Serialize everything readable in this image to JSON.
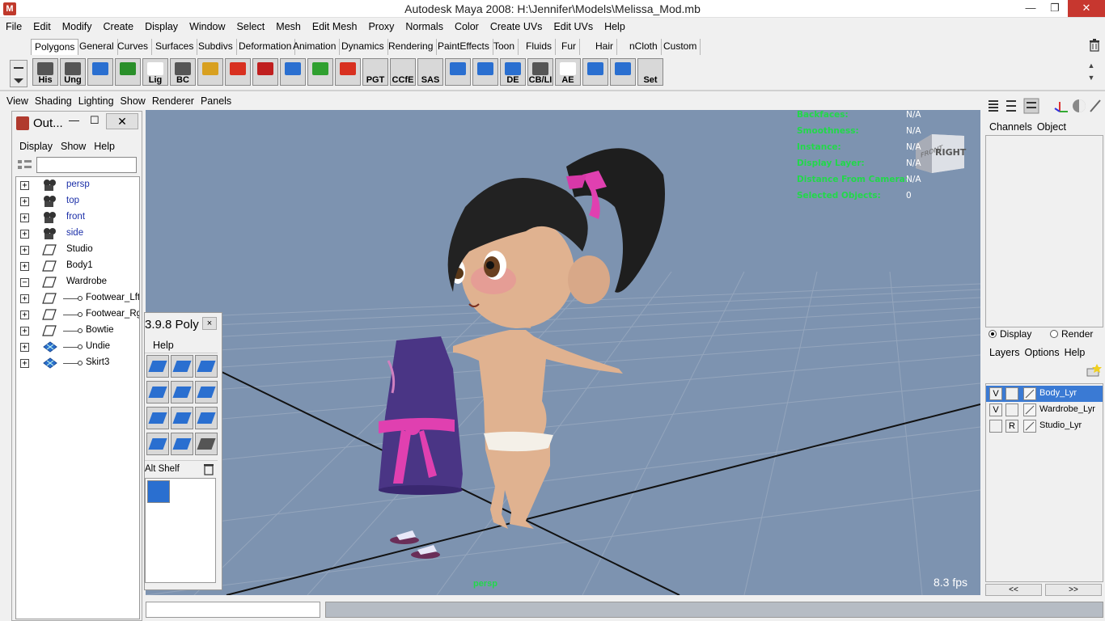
{
  "window": {
    "title": "Autodesk Maya 2008: H:\\Jennifer\\Models\\Melissa_Mod.mb",
    "minimize": "—",
    "maximize": "❐",
    "close": "✕"
  },
  "menubar": [
    "File",
    "Edit",
    "Modify",
    "Create",
    "Display",
    "Window",
    "Select",
    "Mesh",
    "Edit Mesh",
    "Proxy",
    "Normals",
    "Color",
    "Create UVs",
    "Edit UVs",
    "Help"
  ],
  "shelf_tabs": [
    "Polygons",
    "General",
    "Curves",
    "Surfaces",
    "Subdivs",
    "Deformation",
    "Animation",
    "Dynamics",
    "Rendering",
    "PaintEffects",
    "Toon",
    "Fluids",
    "Fur",
    "Hair",
    "nCloth",
    "Custom"
  ],
  "shelf_active_tab": "Polygons",
  "shelf_icons": [
    {
      "label": "His",
      "color": "#555555"
    },
    {
      "label": "Ung",
      "color": "#555555"
    },
    {
      "label": "",
      "color": "#2a6fd0"
    },
    {
      "label": "",
      "color": "#2a8f2a"
    },
    {
      "label": "Lig",
      "color": "#ffffff"
    },
    {
      "label": "BC",
      "color": "#555555"
    },
    {
      "label": "",
      "color": "#d8a020"
    },
    {
      "label": "",
      "color": "#d83020"
    },
    {
      "label": "",
      "color": "#c02020"
    },
    {
      "label": "",
      "color": "#2a6fd0"
    },
    {
      "label": "",
      "color": "#30a030"
    },
    {
      "label": "",
      "color": "#d83020"
    },
    {
      "label": "PGT",
      "color": "#d8d8d8"
    },
    {
      "label": "CCfE",
      "color": "#d8d8d8"
    },
    {
      "label": "SAS",
      "color": "#d8d8d8"
    },
    {
      "label": "",
      "color": "#2a6fd0"
    },
    {
      "label": "",
      "color": "#2a6fd0"
    },
    {
      "label": "DE",
      "color": "#2a6fd0"
    },
    {
      "label": "CB/LI",
      "color": "#555555"
    },
    {
      "label": "AE",
      "color": "#ffffff"
    },
    {
      "label": "",
      "color": "#2a6fd0"
    },
    {
      "label": "",
      "color": "#2a6fd0"
    },
    {
      "label": "Set",
      "color": "#d8d8d8"
    }
  ],
  "panel_menu": [
    "View",
    "Shading",
    "Lighting",
    "Show",
    "Renderer",
    "Panels"
  ],
  "outliner": {
    "title": "Out...",
    "menu": [
      "Display",
      "Show",
      "Help"
    ],
    "filter_value": "",
    "items": [
      {
        "name": "persp",
        "type": "camera",
        "expander": "+",
        "indent": 0
      },
      {
        "name": "top",
        "type": "camera",
        "expander": "+",
        "indent": 0
      },
      {
        "name": "front",
        "type": "camera",
        "expander": "+",
        "indent": 0
      },
      {
        "name": "side",
        "type": "camera",
        "expander": "+",
        "indent": 0
      },
      {
        "name": "Studio",
        "type": "transform",
        "expander": "+",
        "indent": 0
      },
      {
        "name": "Body1",
        "type": "transform",
        "expander": "+",
        "indent": 0
      },
      {
        "name": "Wardrobe",
        "type": "transform",
        "expander": "−",
        "indent": 0
      },
      {
        "name": "Footwear_Lft",
        "type": "transform",
        "expander": "+",
        "indent": 1
      },
      {
        "name": "Footwear_Rgt",
        "type": "transform",
        "expander": "+",
        "indent": 1
      },
      {
        "name": "Bowtie",
        "type": "transform",
        "expander": "+",
        "indent": 1
      },
      {
        "name": "Undie",
        "type": "mesh",
        "expander": "+",
        "indent": 1
      },
      {
        "name": "Skirt3",
        "type": "mesh",
        "expander": "+",
        "indent": 1
      }
    ]
  },
  "float_shelf": {
    "title": "3.9.8 Poly",
    "close": "×",
    "menu": "Help",
    "alt_label": "Alt Shelf"
  },
  "viewport": {
    "hud": [
      {
        "label": "Backfaces:",
        "value": "N/A"
      },
      {
        "label": "Smoothness:",
        "value": "N/A"
      },
      {
        "label": "Instance:",
        "value": "N/A"
      },
      {
        "label": "Display Layer:",
        "value": "N/A"
      },
      {
        "label": "Distance From Camera:",
        "value": "N/A"
      },
      {
        "label": "Selected Objects:",
        "value": "0"
      }
    ],
    "viewcube_front": "FRONT",
    "viewcube_right": "RIGHT",
    "camera_name": "persp",
    "fps": "8.3 fps"
  },
  "channel_box": {
    "menu": [
      "Channels",
      "Object"
    ]
  },
  "layer_editor": {
    "radio_display": "Display",
    "radio_render": "Render",
    "menu": [
      "Layers",
      "Options",
      "Help"
    ],
    "layers": [
      {
        "v": "V",
        "r": "",
        "name": "Body_Lyr",
        "selected": true
      },
      {
        "v": "V",
        "r": "",
        "name": "Wardrobe_Lyr",
        "selected": false
      },
      {
        "v": "",
        "r": "R",
        "name": "Studio_Lyr",
        "selected": false
      }
    ],
    "nav_left": "<<",
    "nav_right": ">>"
  },
  "colors": {
    "viewport_bg": "#7d93b0",
    "hud_green": "#22d84a",
    "selection_blue": "#3a7ad4",
    "close_red": "#c7372f"
  }
}
